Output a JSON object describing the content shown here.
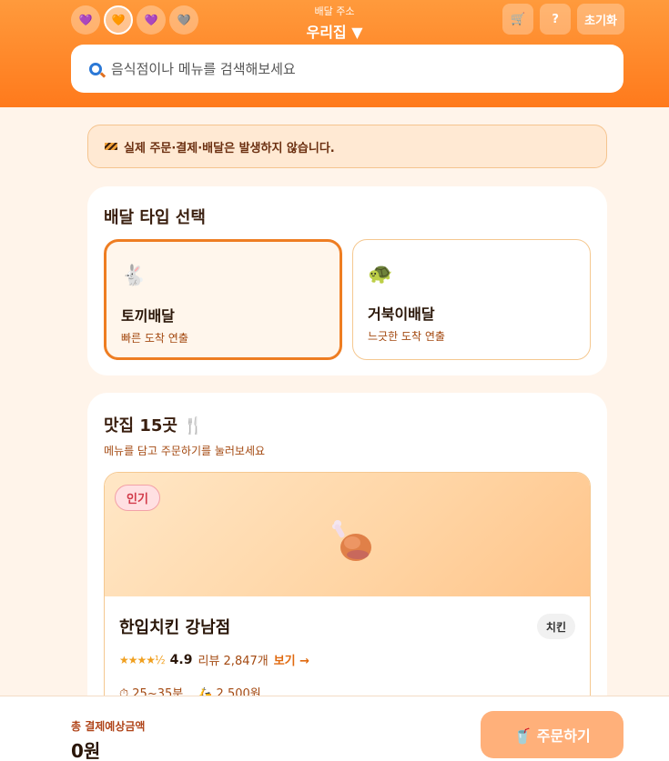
{
  "header": {
    "profiles": [
      {
        "icon": "purple-heart-icon",
        "glyph": "💜"
      },
      {
        "icon": "orange-heart-icon",
        "glyph": "🧡"
      },
      {
        "icon": "purple-heart-icon",
        "glyph": "💜"
      },
      {
        "icon": "gray-heart-icon",
        "glyph": "🩶"
      }
    ],
    "address_label": "배달 주소",
    "address_value": "우리집 ▼",
    "cart_icon": "🛒",
    "help_label": "?",
    "reset_label": "초기화"
  },
  "search": {
    "placeholder": "음식점이나 메뉴를 검색해보세요"
  },
  "notice": {
    "text": "실제 주문·결제·배달은 발생하지 않습니다."
  },
  "delivery_type": {
    "title": "배달 타입 선택",
    "options": [
      {
        "emoji": "🐇",
        "name": "토끼배달",
        "desc": "빠른 도착 연출",
        "selected": true
      },
      {
        "emoji": "🐢",
        "name": "거북이배달",
        "desc": "느긋한 도착 연출",
        "selected": false
      }
    ]
  },
  "restaurants": {
    "title": "맛집 15곳 🍴",
    "subtitle": "메뉴를 담고 주문하기를 눌러보세요",
    "items": [
      {
        "badge": "인기",
        "name": "한입치킨 강남점",
        "category": "치킨",
        "stars": "★★★★½",
        "rating": "4.9",
        "reviews": "리뷰 2,847개",
        "more": "보기 →",
        "time": "⏱ 25~35분",
        "fee": "🛵 2,500원"
      }
    ]
  },
  "footer": {
    "total_label": "총 결제예상금액",
    "total_value": "0원",
    "order_label": "🥤 주문하기"
  },
  "colors": {
    "accent": "#ff7a1c",
    "background": "#fff4ea",
    "selected_border": "#ee7d22"
  }
}
